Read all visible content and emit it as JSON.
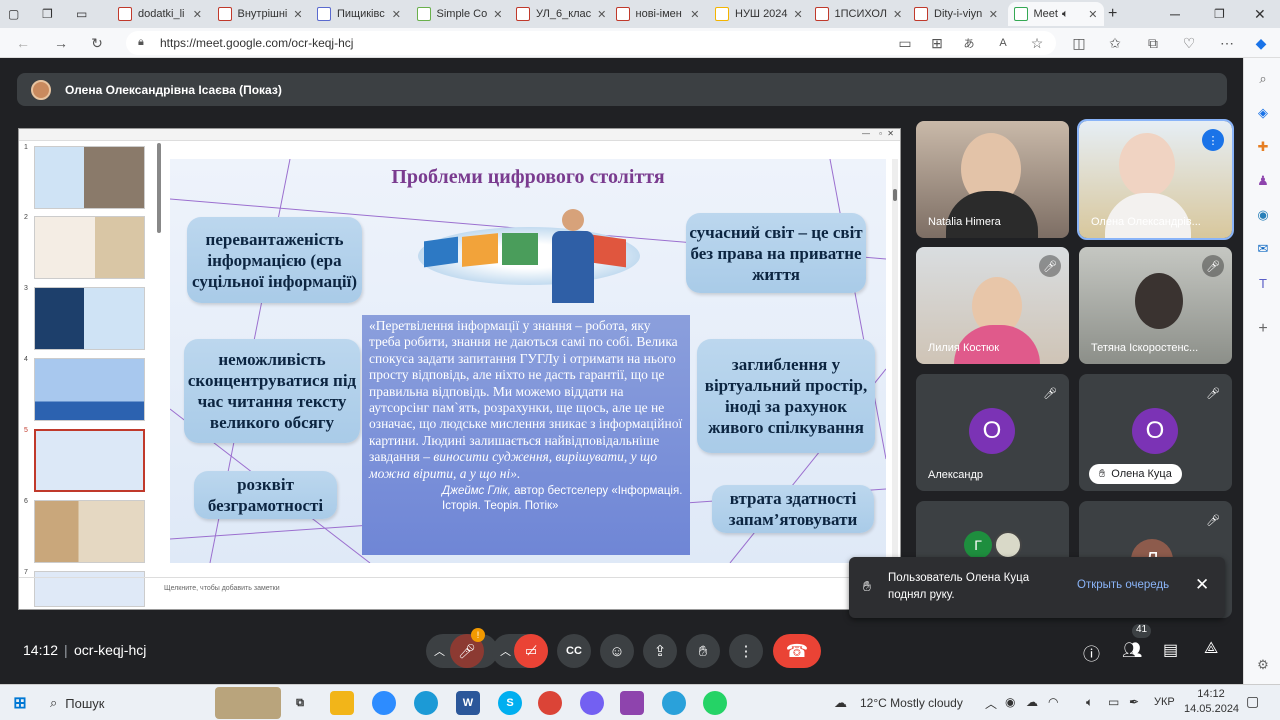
{
  "browser": {
    "tabs": [
      {
        "label": "dodatki_li",
        "color": "#c0392b"
      },
      {
        "label": "Внутрішні",
        "color": "#c0392b"
      },
      {
        "label": "Пищиківс",
        "color": "#5a6acf"
      },
      {
        "label": "Simple Co",
        "color": "#6ab04c"
      },
      {
        "label": "УЛ_6_клас",
        "color": "#c0392b"
      },
      {
        "label": "нові-імен",
        "color": "#c0392b"
      },
      {
        "label": "НУШ 2024",
        "color": "#f4b400"
      },
      {
        "label": "1ПСИХОЛ",
        "color": "#c0392b"
      },
      {
        "label": "Dity-i-viyn",
        "color": "#c0392b"
      },
      {
        "label": "Meet",
        "color": "#34a853"
      }
    ],
    "url": "https://meet.google.com/ocr-keqj-hcj"
  },
  "meet": {
    "presenter": "Олена Олександрівна Ісаєва (Показ)",
    "time": "14:12",
    "meeting_code": "ocr-keqj-hcj",
    "participants_count": "41",
    "mic_badge": "!",
    "tiles": [
      {
        "name": "Natalia Himera"
      },
      {
        "name": "Олена Олександрів..."
      },
      {
        "name": "Лилия Костюк"
      },
      {
        "name": "Тетяна Іскоростенс..."
      },
      {
        "name": "Александр",
        "initial": "О"
      },
      {
        "name": "Олена Куца",
        "initial": "О"
      },
      {
        "initial": "Г"
      },
      {
        "initial": "Л"
      }
    ],
    "toast": {
      "text": "Пользователь Олена Куца поднял руку.",
      "action": "Открыть очередь"
    }
  },
  "slide": {
    "title": "Проблеми цифрового століття",
    "bubbles": [
      "перевантаженість інформацією (ера суцільної інформації)",
      "неможливість сконцентруватися під час читання тексту великого обсягу",
      "розквіт безграмотності",
      "сучасний світ – це світ без права на приватне життя",
      "заглиблення у віртуальний простір, іноді за рахунок живого спілкування",
      "втрата здатності запам’ятовувати"
    ],
    "quote": "«Перетвілення інформації у знання – робота, яку треба робити, знання не даються самі по собі. Велика спокуса задати запитання ГУГЛу і отримати на нього просту відповідь, але ніхто не дасть гарантії, що це правильна відповідь. Ми можемо віддати на аутсорсінг пам`ять, розрахунки, ще щось, але це не означає, що людське мислення зникає з інформаційної картини. Людині залишається найвідповідальніше завдання –",
    "quote_italic": "виносити судження, вирішувати, у що можна вірити, а у що ні».",
    "quote_author": "Джеймс Глік,",
    "quote_author_rest": "автор бестселеру «Інформація. Історія. Теорія. Потік»",
    "notes": "Щелкните, чтобы добавить заметки",
    "thumb_numbers": [
      "1",
      "2",
      "3",
      "4",
      "5",
      "6",
      "7"
    ]
  },
  "taskbar": {
    "search": "Пошук",
    "weather": "12°C  Mostly cloudy",
    "lang": "УКР",
    "time": "14:12",
    "date": "14.05.2024"
  }
}
